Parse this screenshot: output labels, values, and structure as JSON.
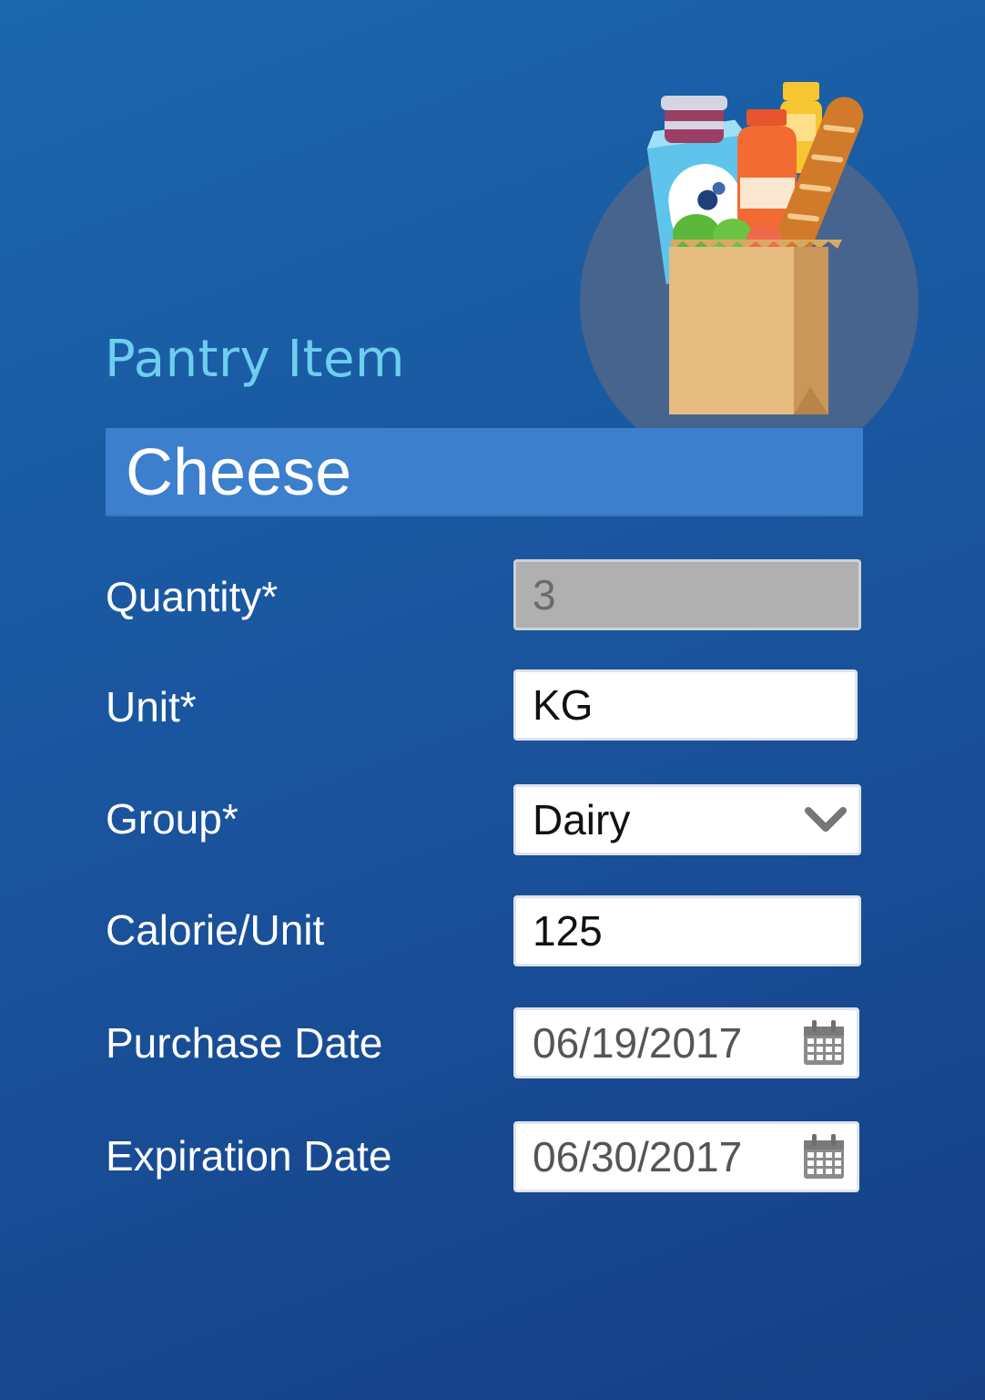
{
  "header": {
    "title": "Pantry Item"
  },
  "item": {
    "name": "Cheese"
  },
  "form": {
    "quantity": {
      "label": "Quantity*",
      "value": "3"
    },
    "unit": {
      "label": "Unit*",
      "value": "KG"
    },
    "group": {
      "label": "Group*",
      "selected": "Dairy",
      "icon": "chevron-down-icon"
    },
    "calorie": {
      "label": "Calorie/Unit",
      "value": "125"
    },
    "purchase_date": {
      "label": "Purchase Date",
      "value": "06/19/2017",
      "icon": "calendar-icon"
    },
    "expiration_date": {
      "label": "Expiration Date",
      "value": "06/30/2017",
      "icon": "calendar-icon"
    }
  },
  "colors": {
    "background": "#1a5aa3",
    "title": "#6fcdf0",
    "name_field": "#3c7fcc",
    "readonly_field": "#b0b0b0",
    "hero_circle": "#47648e"
  },
  "illustration": {
    "icon": "grocery-bag-icon"
  }
}
